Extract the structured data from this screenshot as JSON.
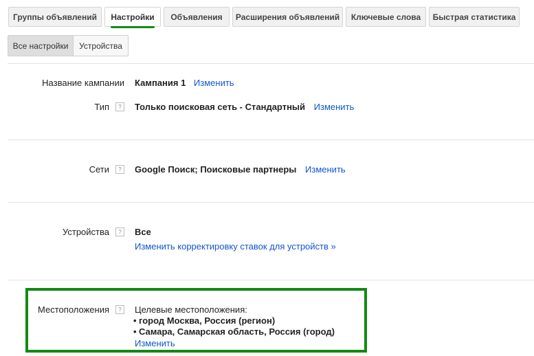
{
  "tabs": [
    {
      "label": "Группы объявлений"
    },
    {
      "label": "Настройки"
    },
    {
      "label": "Объявления"
    },
    {
      "label": "Расширения объявлений"
    },
    {
      "label": "Ключевые слова"
    },
    {
      "label": "Быстрая статистика"
    }
  ],
  "active_tab": "Настройки",
  "subtabs": [
    {
      "label": "Все настройки"
    },
    {
      "label": "Устройства"
    }
  ],
  "settings": {
    "campaign_name": {
      "label": "Название кампании",
      "value": "Кампания 1",
      "action": "Изменить"
    },
    "type": {
      "label": "Тип",
      "help": "?",
      "value": "Только поисковая сеть - Стандартный",
      "action": "Изменить"
    },
    "networks": {
      "label": "Сети",
      "help": "?",
      "value": "Google Поиск; Поисковые партнеры",
      "action": "Изменить"
    },
    "devices": {
      "label": "Устройства",
      "help": "?",
      "value": "Все",
      "action": "Изменить корректировку ставок для устройств »"
    },
    "locations": {
      "label": "Местоположения",
      "help": "?",
      "heading": "Целевые местоположения:",
      "items": [
        "город Москва, Россия (регион)",
        "Самара, Самарская область, Россия (город)"
      ],
      "action": "Изменить"
    }
  },
  "colors": {
    "accent": "#138a13",
    "link": "#1155cc"
  }
}
